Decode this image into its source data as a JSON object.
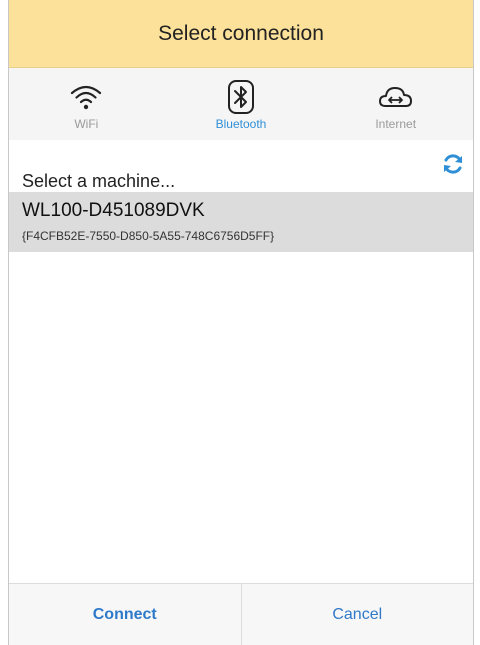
{
  "dialog": {
    "title": "Select connection"
  },
  "tabs": [
    {
      "label": "WiFi",
      "icon": "wifi-icon",
      "active": false
    },
    {
      "label": "Bluetooth",
      "icon": "bluetooth-icon",
      "active": true
    },
    {
      "label": "Internet",
      "icon": "cloud-sync-icon",
      "active": false
    }
  ],
  "list": {
    "subheader": "Select a machine...",
    "refresh_icon": "refresh-icon",
    "items": [
      {
        "name": "WL100-D451089DVK",
        "id": "{F4CFB52E-7550-D850-5A55-748C6756D5FF}",
        "selected": true
      }
    ]
  },
  "footer": {
    "connect_label": "Connect",
    "cancel_label": "Cancel"
  },
  "colors": {
    "title_bg": "#fbe199",
    "accent": "#2f8fd6",
    "selected_row": "#dcdcdc"
  }
}
